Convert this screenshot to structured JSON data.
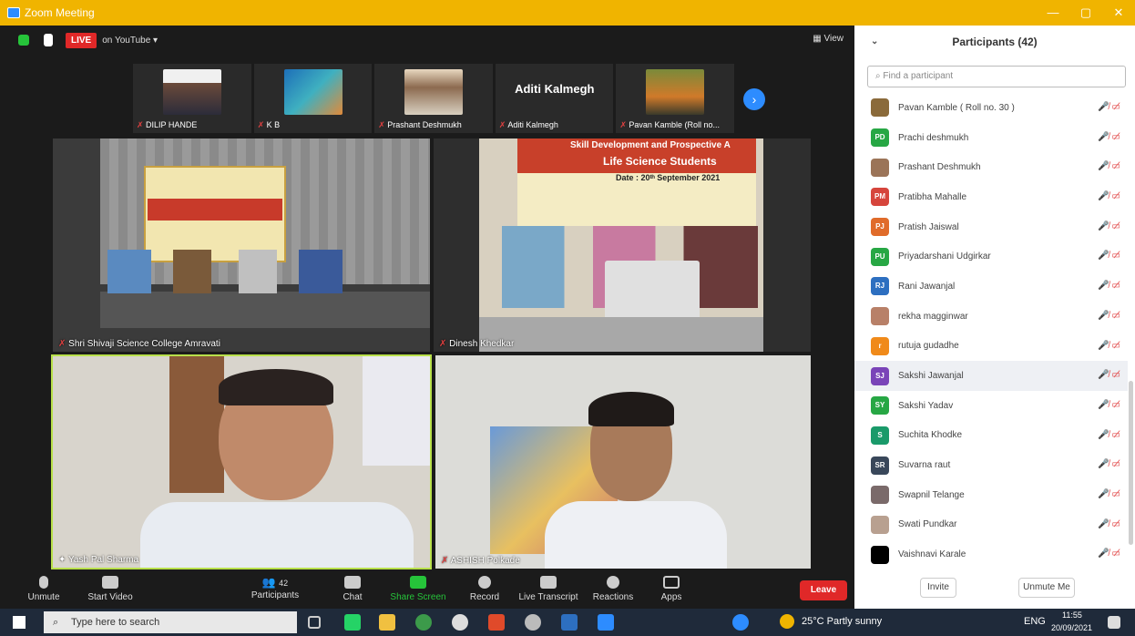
{
  "window": {
    "title": "Zoom Meeting",
    "minimize": "—",
    "maximize": "▢",
    "close": "✕"
  },
  "topbar": {
    "live": "LIVE",
    "youtube": "on YouTube ▾",
    "view": "▦ View"
  },
  "strip": [
    {
      "name": "DILIP HANDE",
      "face_color": "#6b4a3a"
    },
    {
      "name": "K B",
      "face_color": "#2f7fc1"
    },
    {
      "name": "Prashant Deshmukh",
      "face_color": "#8c6a4f"
    },
    {
      "name": "Aditi Kalmegh",
      "big": "Aditi Kalmegh"
    },
    {
      "name": "Pavan Kamble (Roll no...",
      "face_color": "#6a7a2a"
    }
  ],
  "tiles": {
    "t1": {
      "label": "Shri Shivaji Science College Amravati"
    },
    "t2": {
      "label": "Dinesh Khedkar",
      "banner_line1": "Skill Development and Prospective A",
      "banner_line2": "Life Science Students",
      "banner_date": "Date : 20ᵗʰ September 2021"
    },
    "t3": {
      "label": "Yash Pal Sharma"
    },
    "t4": {
      "label": "ASHISH Polkade"
    }
  },
  "toolbar": {
    "unmute": "Unmute",
    "start_video": "Start Video",
    "participants": "Participants",
    "participants_count": "42",
    "chat": "Chat",
    "share": "Share Screen",
    "record": "Record",
    "transcript": "Live Transcript",
    "reactions": "Reactions",
    "apps": "Apps",
    "leave": "Leave"
  },
  "panel": {
    "title": "Participants (42)",
    "search_placeholder": "Find a participant",
    "invite": "Invite",
    "unmute_me": "Unmute Me",
    "participants": [
      {
        "name": "Pavan Kamble ( Roll no. 30 )",
        "initials": "",
        "color": "#8a6a3a"
      },
      {
        "name": "Prachi deshmukh",
        "initials": "PD",
        "color": "#27a744"
      },
      {
        "name": "Prashant Deshmukh",
        "initials": "",
        "color": "#9b7458"
      },
      {
        "name": "Pratibha Mahalle",
        "initials": "PM",
        "color": "#d6453c"
      },
      {
        "name": "Pratish Jaiswal",
        "initials": "PJ",
        "color": "#e06b2a"
      },
      {
        "name": "Priyadarshani Udgirkar",
        "initials": "PU",
        "color": "#27a744"
      },
      {
        "name": "Rani Jawanjal",
        "initials": "RJ",
        "color": "#2d6fc0"
      },
      {
        "name": "rekha magginwar",
        "initials": "",
        "color": "#b88068"
      },
      {
        "name": "rutuja gudadhe",
        "initials": "r",
        "color": "#f08a1a"
      },
      {
        "name": "Sakshi Jawanjal",
        "initials": "SJ",
        "color": "#7a44b8"
      },
      {
        "name": "Sakshi Yadav",
        "initials": "SY",
        "color": "#27a744"
      },
      {
        "name": "Suchita Khodke",
        "initials": "S",
        "color": "#1a9a6a"
      },
      {
        "name": "Suvarna raut",
        "initials": "SR",
        "color": "#39475a"
      },
      {
        "name": "Swapnil Telange",
        "initials": "",
        "color": "#7a6a6a"
      },
      {
        "name": "Swati Pundkar",
        "initials": "",
        "color": "#b8a090"
      },
      {
        "name": "Vaishnavi Karale",
        "initials": "",
        "color": "#000000"
      }
    ]
  },
  "taskbar": {
    "search": "Type here to search",
    "weather": "25°C  Partly sunny",
    "lang": "ENG",
    "time": "11:55",
    "date": "20/09/2021"
  }
}
